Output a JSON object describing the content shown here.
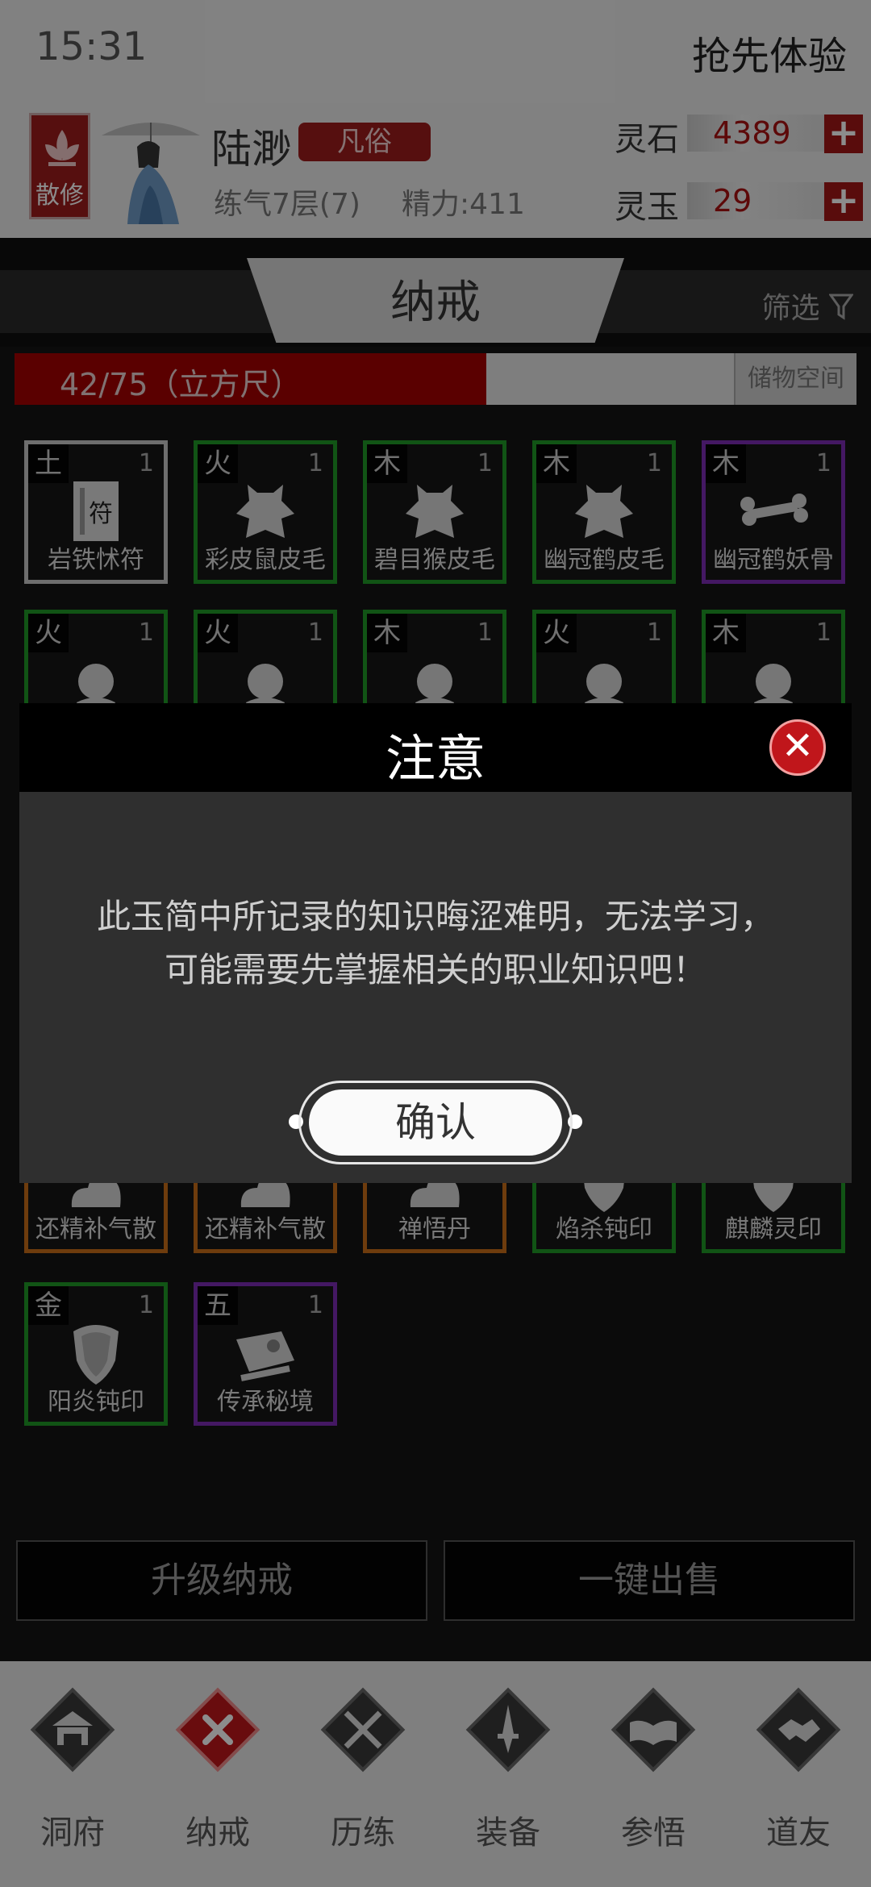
{
  "status_bar": {
    "time": "15:31",
    "preview_label": "抢先体验"
  },
  "player": {
    "sect": "散修",
    "name": "陆渺",
    "rank": "凡俗",
    "level": "练气7层(7)",
    "energy": "精力:411"
  },
  "resources": [
    {
      "label": "灵石",
      "value": "4389"
    },
    {
      "label": "灵玉",
      "value": "29"
    }
  ],
  "header": {
    "title": "纳戒",
    "filter_label": "筛选"
  },
  "capacity": {
    "text": "42/75（立方尺）",
    "used": 42,
    "total": 75,
    "storage_label": "储物空间"
  },
  "items_row1": [
    {
      "element": "土",
      "qty": "1",
      "name": "岩铁怵符",
      "rarity": "white",
      "icon": "talisman-icon"
    },
    {
      "element": "火",
      "qty": "1",
      "name": "彩皮鼠皮毛",
      "rarity": "green",
      "icon": "pelt-icon"
    },
    {
      "element": "木",
      "qty": "1",
      "name": "碧目猴皮毛",
      "rarity": "green",
      "icon": "pelt-icon"
    },
    {
      "element": "木",
      "qty": "1",
      "name": "幽冠鹤皮毛",
      "rarity": "green",
      "icon": "pelt-icon"
    },
    {
      "element": "木",
      "qty": "1",
      "name": "幽冠鹤妖骨",
      "rarity": "purple",
      "icon": "bone-icon"
    }
  ],
  "items_row2": [
    {
      "element": "火",
      "qty": "1",
      "rarity": "green",
      "icon": "orb-icon"
    },
    {
      "element": "火",
      "qty": "1",
      "rarity": "green",
      "icon": "orb-icon"
    },
    {
      "element": "木",
      "qty": "1",
      "rarity": "green",
      "icon": "orb-icon"
    },
    {
      "element": "火",
      "qty": "1",
      "rarity": "green",
      "icon": "orb-icon"
    },
    {
      "element": "木",
      "qty": "1",
      "rarity": "green",
      "icon": "orb-icon"
    }
  ],
  "items_row5": [
    {
      "name": "还精补气散",
      "rarity": "orange",
      "icon": "cloud-icon"
    },
    {
      "name": "还精补气散",
      "rarity": "orange",
      "icon": "cloud-icon"
    },
    {
      "name": "禅悟丹",
      "rarity": "orange",
      "icon": "cloud-icon"
    },
    {
      "name": "焰杀钝印",
      "rarity": "green",
      "icon": "shield-icon"
    },
    {
      "name": "麒麟灵印",
      "rarity": "green",
      "icon": "shield-icon"
    }
  ],
  "items_row6": [
    {
      "element": "金",
      "qty": "1",
      "name": "阳炎钝印",
      "rarity": "green",
      "icon": "shield-icon"
    },
    {
      "element": "五",
      "qty": "1",
      "name": "传承秘境",
      "rarity": "purple",
      "icon": "scroll-map-icon"
    }
  ],
  "actions": {
    "upgrade": "升级纳戒",
    "sell_all": "一键出售"
  },
  "nav": [
    {
      "label": "洞府",
      "icon": "pavilion-icon"
    },
    {
      "label": "纳戒",
      "icon": "ring-icon"
    },
    {
      "label": "历练",
      "icon": "crossed-swords-icon"
    },
    {
      "label": "装备",
      "icon": "dagger-icon"
    },
    {
      "label": "参悟",
      "icon": "open-book-icon"
    },
    {
      "label": "道友",
      "icon": "handshake-icon"
    }
  ],
  "modal": {
    "title": "注意",
    "message": "此玉简中所记录的知识晦涩难明，无法学习，可能需要先掌握相关的职业知识吧！",
    "confirm": "确认"
  },
  "colors": {
    "accent_red": "#a40000",
    "green": "#1f9a27",
    "purple": "#7d2cb5",
    "orange": "#c86e18"
  }
}
